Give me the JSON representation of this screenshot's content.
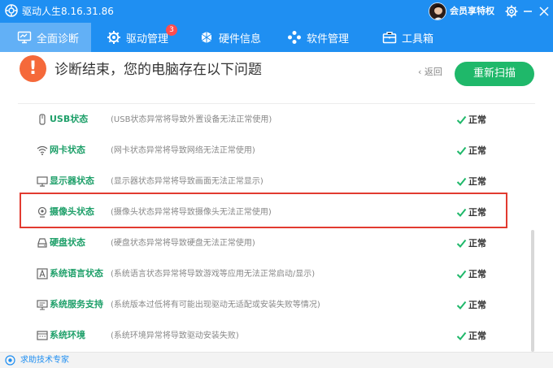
{
  "window": {
    "title": "驱动人生8.16.31.86",
    "member_label": "会员享特权",
    "icons": [
      "app-logo-icon",
      "gear-icon",
      "minimize-icon",
      "close-icon"
    ]
  },
  "nav": {
    "tabs": [
      {
        "label": "全面诊断",
        "icon": "monitor-icon",
        "active": true
      },
      {
        "label": "驱动管理",
        "icon": "gear-icon",
        "badge": "3"
      },
      {
        "label": "硬件信息",
        "icon": "chip-icon"
      },
      {
        "label": "软件管理",
        "icon": "apps-icon"
      },
      {
        "label": "工具箱",
        "icon": "toolbox-icon"
      }
    ]
  },
  "header": {
    "alert_symbol": "!",
    "headline": "诊断结束，您的电脑存在以下问题",
    "back_label": "返回",
    "rescan_label": "重新扫描"
  },
  "rows": [
    {
      "name": "USB状态",
      "desc": "(USB状态异常将导致外置设备无法正常使用)",
      "status": "正常",
      "icon": "usb-icon"
    },
    {
      "name": "网卡状态",
      "desc": "(网卡状态异常将导致网络无法正常使用)",
      "status": "正常",
      "icon": "wifi-icon"
    },
    {
      "name": "显示器状态",
      "desc": "(显示器状态异常将导致画面无法正常显示)",
      "status": "正常",
      "icon": "display-icon"
    },
    {
      "name": "摄像头状态",
      "desc": "(摄像头状态异常将导致摄像头无法正常使用)",
      "status": "正常",
      "icon": "camera-icon",
      "highlighted": true
    },
    {
      "name": "硬盘状态",
      "desc": "(硬盘状态异常将导致硬盘无法正常使用)",
      "status": "正常",
      "icon": "harddisk-icon"
    },
    {
      "name": "系统语言状态",
      "desc": "(系统语言状态异常将导致游戏等应用无法正常启动/显示)",
      "status": "正常",
      "icon": "language-icon"
    },
    {
      "name": "系统服务支持",
      "desc": "(系统版本过低将有可能出现驱动无适配或安装失败等情况)",
      "status": "正常",
      "icon": "service-icon"
    },
    {
      "name": "系统环境",
      "desc": "(系统环境异常将导致驱动安装失败)",
      "status": "正常",
      "icon": "environment-icon"
    }
  ],
  "footer": {
    "help_label": "求助技术专家"
  },
  "colors": {
    "primary": "#1f8ff2",
    "active_tab": "#62b0f6",
    "ok_green": "#1fb86a",
    "alert_orange": "#f5693a",
    "highlight_red": "#e23b30"
  }
}
